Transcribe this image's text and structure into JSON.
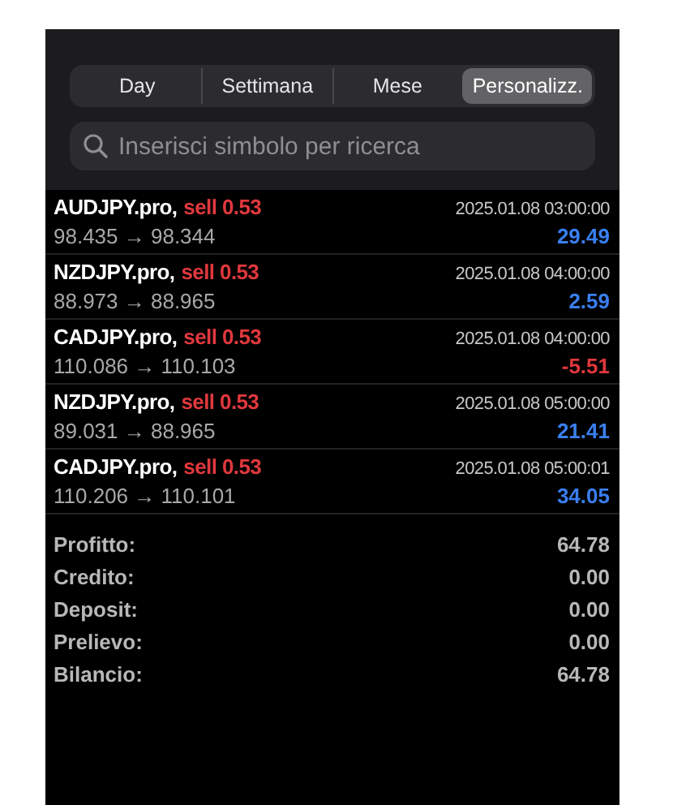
{
  "tabs": [
    {
      "label": "Day",
      "selected": false
    },
    {
      "label": "Settimana",
      "selected": false
    },
    {
      "label": "Mese",
      "selected": false
    },
    {
      "label": "Personalizz.",
      "selected": true
    }
  ],
  "search": {
    "placeholder": "Inserisci simbolo per ricerca"
  },
  "trades": [
    {
      "symbol": "AUDJPY.pro,",
      "side": "sell 0.53",
      "time": "2025.01.08 03:00:00",
      "prices": "98.435 → 98.344",
      "profit": "29.49",
      "color": "#3a7ff0"
    },
    {
      "symbol": "NZDJPY.pro,",
      "side": "sell 0.53",
      "time": "2025.01.08 04:00:00",
      "prices": "88.973 → 88.965",
      "profit": "2.59",
      "color": "#3a7ff0"
    },
    {
      "symbol": "CADJPY.pro,",
      "side": "sell 0.53",
      "time": "2025.01.08 04:00:00",
      "prices": "110.086 → 110.103",
      "profit": "-5.51",
      "color": "#e0383e"
    },
    {
      "symbol": "NZDJPY.pro,",
      "side": "sell 0.53",
      "time": "2025.01.08 05:00:00",
      "prices": "89.031 → 88.965",
      "profit": "21.41",
      "color": "#3a7ff0"
    },
    {
      "symbol": "CADJPY.pro,",
      "side": "sell 0.53",
      "time": "2025.01.08 05:00:01",
      "prices": "110.206 → 110.101",
      "profit": "34.05",
      "color": "#3a7ff0"
    }
  ],
  "summary": [
    {
      "label": "Profitto:",
      "value": "64.78"
    },
    {
      "label": "Credito:",
      "value": "0.00"
    },
    {
      "label": "Deposit:",
      "value": "0.00"
    },
    {
      "label": "Prelievo:",
      "value": "0.00"
    },
    {
      "label": "Bilancio:",
      "value": "64.78"
    }
  ]
}
